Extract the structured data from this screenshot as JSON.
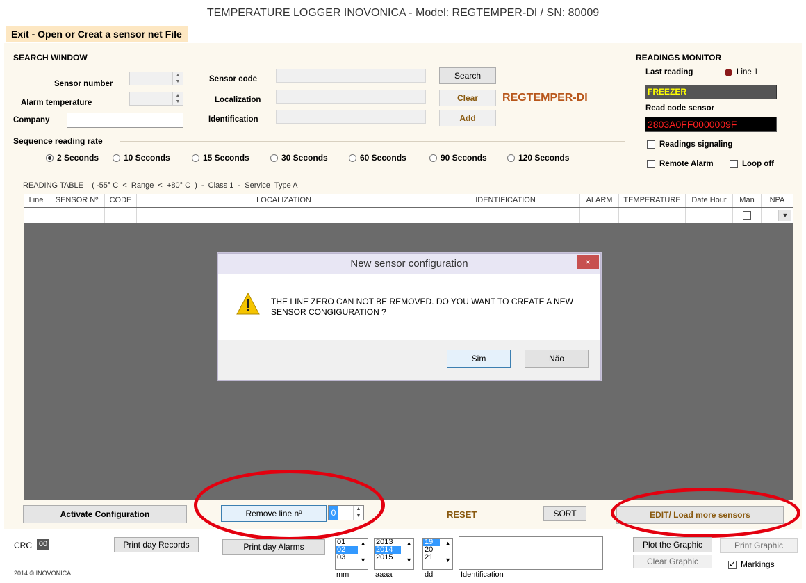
{
  "window": {
    "title": "TEMPERATURE LOGGER INOVONICA - Model: REGTEMPER-DI  /  SN: 80009"
  },
  "menu": {
    "exit_label": "Exit - Open or Creat a sensor net File"
  },
  "search": {
    "title": "SEARCH WINDOW",
    "sensor_number_label": "Sensor number",
    "alarm_temperature_label": "Alarm temperature",
    "company_label": "Company",
    "sensor_code_label": "Sensor code",
    "localization_label": "Localization",
    "identification_label": "Identification",
    "search_button": "Search",
    "clear_button": "Clear",
    "add_button": "Add",
    "model_label": "REGTEMPER-DI"
  },
  "sequence": {
    "title": "Sequence reading rate",
    "options": [
      "2 Seconds",
      "10 Seconds",
      "15 Seconds",
      "30 Seconds",
      "60 Seconds",
      "90 Seconds",
      "120 Seconds"
    ],
    "selected": "2 Seconds"
  },
  "monitor": {
    "title": "READINGS MONITOR",
    "last_reading_label": "Last reading",
    "line_label": "Line  1",
    "last_value": "FREEZER",
    "read_code_label": "Read code sensor",
    "code_value": "2803A0FF0000009F",
    "signaling_label": "Readings signaling",
    "remote_alarm_label": "Remote Alarm",
    "loop_off_label": "Loop off",
    "colors": {
      "value_text": "#ffff00",
      "code_text": "#ff2020",
      "led": "#8b1a1a"
    }
  },
  "table": {
    "caption": "READING TABLE    ( -55° C  <  Range  <  +80° C  )  -  Class 1  -  Service  Type A",
    "columns": [
      "Line",
      "SENSOR Nº",
      "CODE",
      "LOCALIZATION",
      "IDENTIFICATION",
      "ALARM",
      "TEMPERATURE",
      "Date Hour",
      "Man",
      "NPA"
    ]
  },
  "dialog": {
    "title": "New sensor configuration",
    "message": "THE LINE ZERO CAN NOT BE REMOVED. DO YOU WANT TO CREATE A NEW SENSOR CONGIGURATION ?",
    "yes": "Sim",
    "no": "Não",
    "close": "×"
  },
  "bottom": {
    "activate": "Activate Configuration",
    "remove_line": "Remove line  nº",
    "remove_value": "0",
    "reset": "RESET",
    "sort": "SORT",
    "edit_load": "EDIT/ Load more sensors",
    "crc_label": "CRC",
    "crc_value": "00",
    "print_records": "Print day Records",
    "print_alarms": "Print day Alarms",
    "months": [
      "01",
      "02",
      "03"
    ],
    "years": [
      "2013",
      "2014",
      "2015"
    ],
    "days": [
      "19",
      "20",
      "21"
    ],
    "mm_label": "mm",
    "aaaa_label": "aaaa",
    "dd_label": "dd",
    "identification_label": "Identification",
    "plot_graphic": "Plot the Graphic",
    "print_graphic": "Print Graphic",
    "clear_graphic": "Clear Graphic",
    "markings": "Markings",
    "copyright": "2014 © INOVONICA"
  }
}
